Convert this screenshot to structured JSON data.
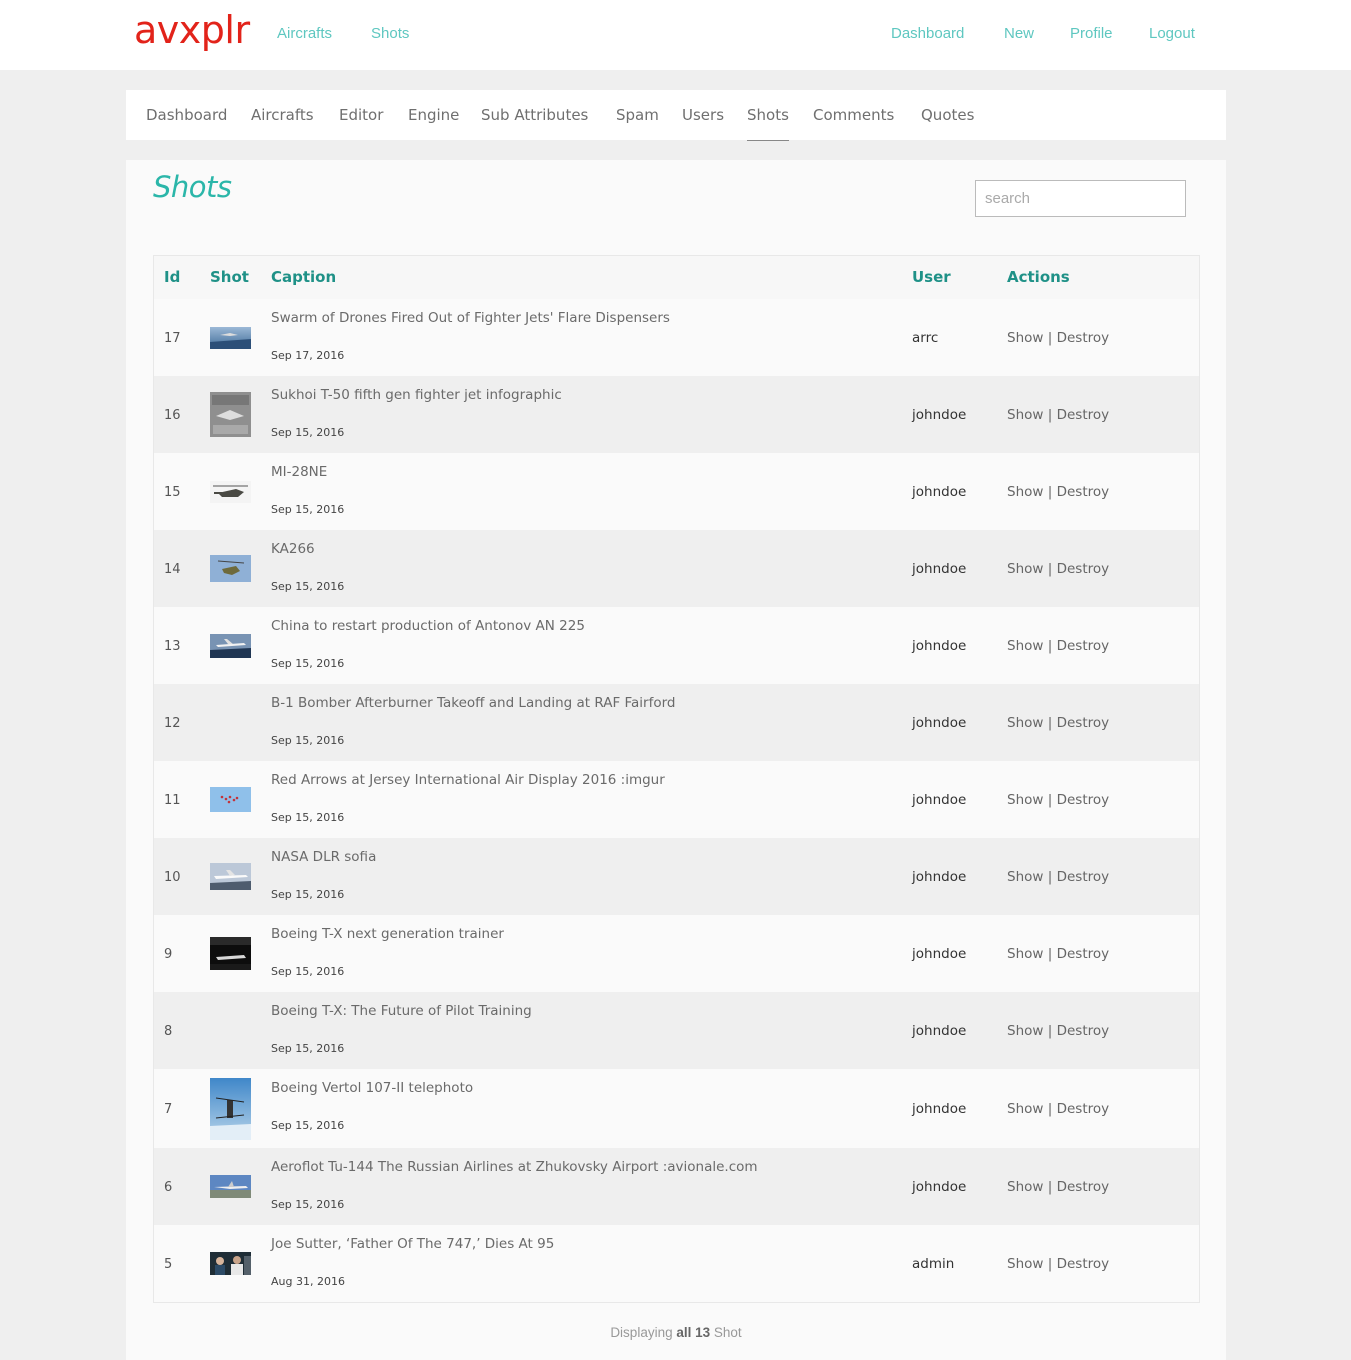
{
  "brand": {
    "logo": "avxplr",
    "brand_color": "#e2231a",
    "accent_color": "#5ec7c0"
  },
  "topnav": {
    "left": [
      "Aircrafts",
      "Shots"
    ],
    "right": [
      "Dashboard",
      "New",
      "Profile",
      "Logout"
    ]
  },
  "admin_tabs": [
    "Dashboard",
    "Aircrafts",
    "Editor",
    "Engine",
    "Sub Attributes",
    "Spam",
    "Users",
    "Shots",
    "Comments",
    "Quotes"
  ],
  "active_tab": "Shots",
  "page": {
    "title": "Shots",
    "search_placeholder": "search"
  },
  "table": {
    "headers": {
      "id": "Id",
      "shot": "Shot",
      "caption": "Caption",
      "user": "User",
      "actions": "Actions"
    },
    "action_show": "Show",
    "action_separator": "|",
    "action_destroy": "Destroy",
    "rows": [
      {
        "id": "17",
        "caption": "Swarm of Drones Fired Out of Fighter Jets' Flare Dispensers",
        "date": "Sep 17, 2016",
        "user": "arrc",
        "thumb": "drones-sky"
      },
      {
        "id": "16",
        "caption": "Sukhoi T-50 fifth gen fighter jet infographic",
        "date": "Sep 15, 2016",
        "user": "johndoe",
        "thumb": "infographic"
      },
      {
        "id": "15",
        "caption": "MI-28NE",
        "date": "Sep 15, 2016",
        "user": "johndoe",
        "thumb": "helicopter"
      },
      {
        "id": "14",
        "caption": "KA266",
        "date": "Sep 15, 2016",
        "user": "johndoe",
        "thumb": "helicopter-sky"
      },
      {
        "id": "13",
        "caption": "China to restart production of Antonov AN 225",
        "date": "Sep 15, 2016",
        "user": "johndoe",
        "thumb": "cargo-jet"
      },
      {
        "id": "12",
        "caption": "B-1 Bomber Afterburner Takeoff and Landing at RAF Fairford",
        "date": "Sep 15, 2016",
        "user": "johndoe",
        "thumb": ""
      },
      {
        "id": "11",
        "caption": "Red Arrows at Jersey International Air Display 2016 :imgur",
        "date": "Sep 15, 2016",
        "user": "johndoe",
        "thumb": "formation"
      },
      {
        "id": "10",
        "caption": "NASA DLR sofia",
        "date": "Sep 15, 2016",
        "user": "johndoe",
        "thumb": "airliner"
      },
      {
        "id": "9",
        "caption": "Boeing T-X next generation trainer",
        "date": "Sep 15, 2016",
        "user": "johndoe",
        "thumb": "hangar-jet"
      },
      {
        "id": "8",
        "caption": "Boeing T-X: The Future of Pilot Training",
        "date": "Sep 15, 2016",
        "user": "johndoe",
        "thumb": ""
      },
      {
        "id": "7",
        "caption": "Boeing Vertol 107-II telephoto",
        "date": "Sep 15, 2016",
        "user": "johndoe",
        "thumb": "vertol-tall"
      },
      {
        "id": "6",
        "caption": "Aeroflot Tu-144 The Russian Airlines at Zhukovsky Airport :avionale.com",
        "date": "Sep 15, 2016",
        "user": "johndoe",
        "thumb": "tu144"
      },
      {
        "id": "5",
        "caption": "Joe Sutter, ‘Father Of The 747,’ Dies At 95",
        "date": "Aug 31, 2016",
        "user": "admin",
        "thumb": "people"
      }
    ]
  },
  "footer": {
    "prefix": "Displaying",
    "all": "all 13",
    "suffix": "Shot"
  }
}
